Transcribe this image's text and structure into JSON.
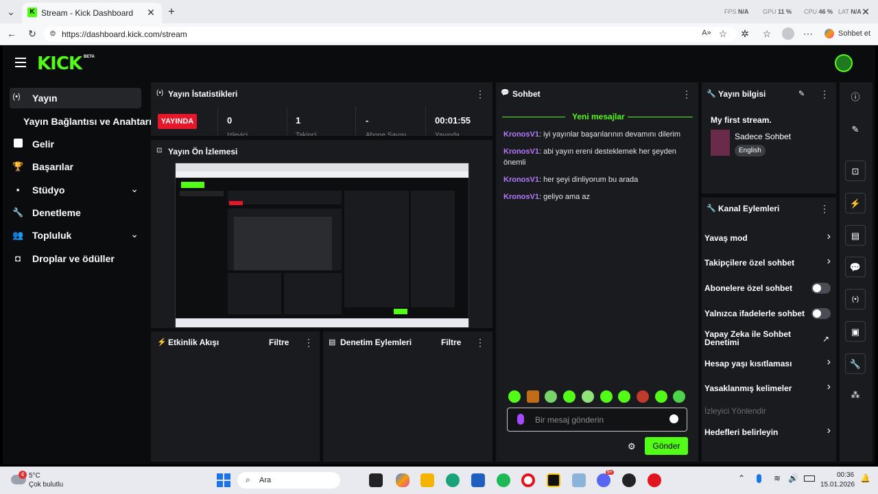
{
  "browser": {
    "tab_title": "Stream - Kick Dashboard",
    "url": "https://dashboard.kick.com/stream",
    "sohbet_button": "Sohbet et",
    "perf": {
      "fps_label": "FPS",
      "fps_val": "N/A",
      "gpu_label": "GPU",
      "gpu_val": "11 %",
      "cpu_label": "CPU",
      "cpu_val": "46 %",
      "lat_label": "LAT",
      "lat_val": "N/A"
    }
  },
  "logo": {
    "text": "KICK",
    "beta": "BETA"
  },
  "sidebar": {
    "items": [
      {
        "label": "Yayın",
        "icon": "broadcast-icon"
      },
      {
        "label": "Yayın Bağlantısı ve Anahtarı",
        "icon": ""
      },
      {
        "label": "Gelir",
        "icon": "revenue-icon"
      },
      {
        "label": "Başarılar",
        "icon": "trophy-icon"
      },
      {
        "label": "Stüdyo",
        "icon": "studio-icon"
      },
      {
        "label": "Denetleme",
        "icon": "wrench-icon"
      },
      {
        "label": "Topluluk",
        "icon": "community-icon"
      },
      {
        "label": "Droplar ve ödüller",
        "icon": "drops-icon"
      }
    ]
  },
  "stats": {
    "title": "Yayın İstatistikleri",
    "live_badge": "YAYINDA",
    "viewers": "0",
    "viewers_label": "İzleyici",
    "followers": "1",
    "followers_label": "Takipçi",
    "subs": "-",
    "subs_label": "Abone Sayısı",
    "uptime": "00:01:55",
    "uptime_label": "Yayında"
  },
  "preview": {
    "title": "Yayın Ön İzlemesi"
  },
  "activity": {
    "title": "Etkinlik Akışı",
    "filter": "Filtre"
  },
  "moderation": {
    "title": "Denetim Eylemleri",
    "filter": "Filtre"
  },
  "chat": {
    "title": "Sohbet",
    "new_messages": "Yeni mesajlar",
    "messages": [
      {
        "user": "KronosV1",
        "text": "iyi yayınlar başarılarının devamını dilerim"
      },
      {
        "user": "KronosV1",
        "text": "abi yayın ereni desteklemek her şeyden önemli"
      },
      {
        "user": "KronosV1",
        "text": "her şeyi dinliyorum bu arada"
      },
      {
        "user": "KronosV1",
        "text": "geliyo ama az"
      }
    ],
    "input_placeholder": "Bir mesaj gönderin",
    "send_button": "Gönder"
  },
  "stream_info": {
    "title": "Yayın bilgisi",
    "stream_title": "My first stream.",
    "category": "Sadece Sohbet",
    "language": "English"
  },
  "channel_actions": {
    "title": "Kanal Eylemleri",
    "items": [
      {
        "label": "Yavaş mod",
        "control": "chevron"
      },
      {
        "label": "Takipçilere özel sohbet",
        "control": "chevron"
      },
      {
        "label": "Abonelere özel sohbet",
        "control": "toggle"
      },
      {
        "label": "Yalnızca ifadelerle sohbet",
        "control": "toggle"
      },
      {
        "label": "Yapay Zeka ile Sohbet Denetimi",
        "control": "external"
      },
      {
        "label": "Hesap yaşı kısıtlaması",
        "control": "chevron"
      },
      {
        "label": "Yasaklanmış kelimeler",
        "control": "chevron"
      },
      {
        "label": "İzleyici Yönlendir",
        "control": "disabled"
      },
      {
        "label": "Hedefleri belirleyin",
        "control": "chevron"
      }
    ]
  },
  "taskbar": {
    "weather_temp": "5°C",
    "weather_desc": "Çok bulutlu",
    "weather_badge": "4",
    "search_label": "Ara",
    "time": "00:36",
    "date": "15.01.2026",
    "discord_badge": "9+"
  },
  "colors": {
    "kick_green": "#53fc18",
    "live_red": "#e5182b",
    "chat_user": "#b57cff"
  }
}
